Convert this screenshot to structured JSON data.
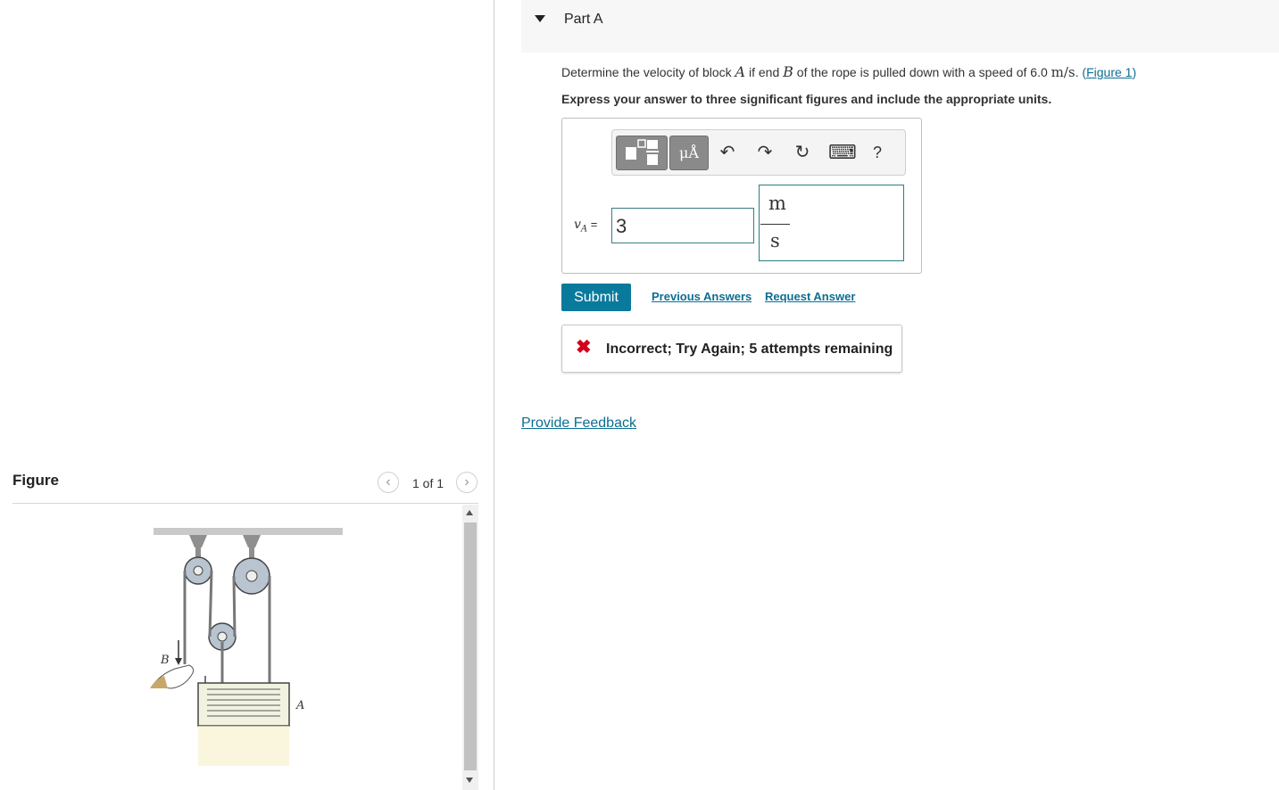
{
  "part": {
    "title": "Part A"
  },
  "question": {
    "pre": "Determine the velocity of block ",
    "var_a": "A",
    "mid": " if end ",
    "var_b": "B",
    "post": " of the rope is pulled down with a speed of 6.0 ",
    "unit": "m/s",
    "dot": ". ",
    "link_open": "(",
    "figure_link": "Figure 1",
    "link_close": ")"
  },
  "instruction": "Express your answer to three significant figures and include the appropriate units.",
  "toolbar": {
    "units_button": "μÅ",
    "undo_icon": "↶",
    "redo_icon": "↷",
    "reset_icon": "↻",
    "keyboard_icon": "⌨",
    "help": "?"
  },
  "answer": {
    "var": "v",
    "sub": "A",
    "eq": "=",
    "value": "3",
    "unit_num": "m",
    "unit_den": "s"
  },
  "buttons": {
    "submit": "Submit",
    "previous_answers": "Previous Answers",
    "request_answer": "Request Answer"
  },
  "feedback": {
    "icon": "✖",
    "message": "Incorrect; Try Again; 5 attempts remaining"
  },
  "provide_feedback": "Provide Feedback",
  "figure": {
    "title": "Figure",
    "page": "1 of 1",
    "label_b": "B",
    "label_a": "A"
  },
  "colors": {
    "accent": "#0a7a9c",
    "link": "#0c6e93",
    "error": "#d0021b"
  }
}
